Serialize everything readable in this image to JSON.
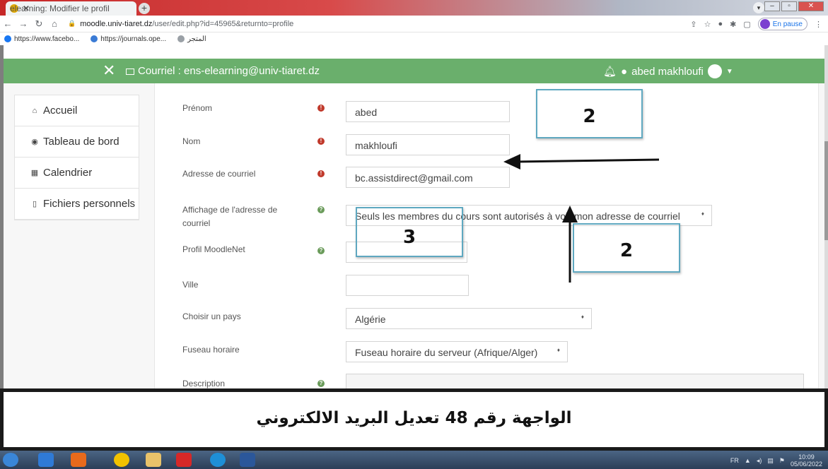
{
  "browser": {
    "tab_title": "elearning: Modifier le profil",
    "url_host": "moodle.univ-tiaret.dz",
    "url_path": "/user/edit.php?id=45965&returnto=profile",
    "profile_status": "En pause",
    "bookmarks": [
      "https://www.facebo...",
      "https://journals.ope...",
      "المتجر"
    ]
  },
  "navbar": {
    "close_label": "✕",
    "mail_text": "Courriel : ens-elearning@univ-tiaret.dz",
    "user_name": "abed makhloufi"
  },
  "sidebar": {
    "items": [
      {
        "label": "Accueil",
        "icon": "home-icon"
      },
      {
        "label": "Tableau de bord",
        "icon": "dashboard-icon"
      },
      {
        "label": "Calendrier",
        "icon": "calendar-icon"
      },
      {
        "label": "Fichiers personnels",
        "icon": "file-icon"
      }
    ]
  },
  "form": {
    "prenom_label": "Prénom",
    "prenom_value": "abed",
    "nom_label": "Nom",
    "nom_value": "makhloufi",
    "email_label": "Adresse de courriel",
    "email_value": "bc.assistdirect@gmail.com",
    "email_display_label": "Affichage de l'adresse de courriel",
    "email_display_value": "Seuls les membres du cours sont autorisés à voir mon adresse de courriel",
    "moodlenet_label": "Profil MoodleNet",
    "moodlenet_value": "",
    "ville_label": "Ville",
    "ville_value": "",
    "pays_label": "Choisir un pays",
    "pays_value": "Algérie",
    "fuseau_label": "Fuseau horaire",
    "fuseau_value": "Fuseau horaire du serveur (Afrique/Alger)",
    "description_label": "Description"
  },
  "annotations": {
    "callout_top": "2",
    "callout_left": "3",
    "callout_right": "2"
  },
  "banner": {
    "text": "الواجهة رقم 48  تعديل البريد الالكتروني"
  },
  "taskbar": {
    "lang": "FR",
    "time": "10:09",
    "date": "05/06/2022"
  },
  "colors": {
    "navbar_green": "#6aaf6c",
    "required_red": "#c0392b",
    "callout_blue": "#5fa8c0"
  }
}
